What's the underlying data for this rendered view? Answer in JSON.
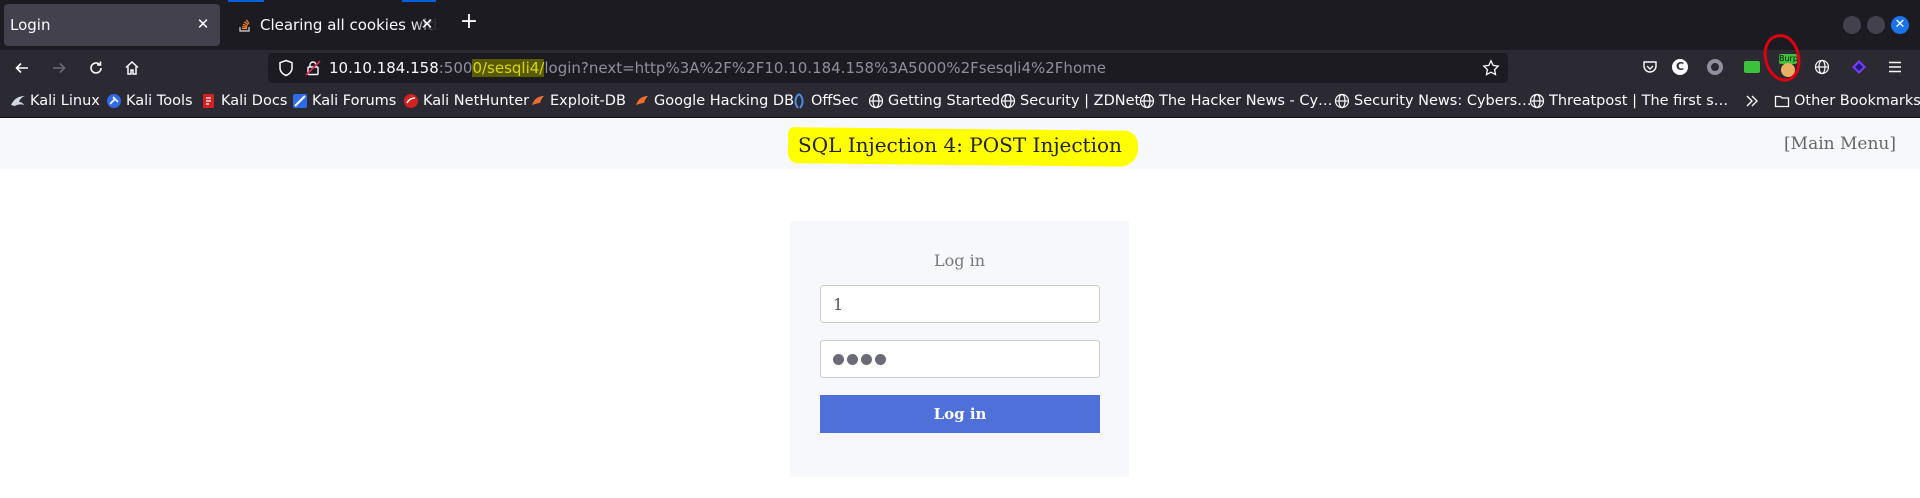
{
  "browser": {
    "tabs": [
      {
        "title": "Login",
        "active": true
      },
      {
        "title": "Clearing all cookies with JavaScript",
        "active": false
      }
    ],
    "url": {
      "host": "10.10.184.158",
      "port": ":500",
      "highlighted": "0/sesqli4/",
      "rest": "login?next=http%3A%2F%2F10.10.184.158%3A5000%2Fsesqli4%2Fhome"
    },
    "extensions": [
      {
        "name": "pocket-icon"
      },
      {
        "name": "c-extension-icon",
        "text": "C"
      },
      {
        "name": "settings-extension-icon"
      },
      {
        "name": "green-extension-icon"
      },
      {
        "name": "burp-extension-icon",
        "text": "Burp"
      },
      {
        "name": "globe-extension-icon"
      },
      {
        "name": "purple-extension-icon"
      },
      {
        "name": "menu-icon"
      }
    ],
    "bookmarks": [
      "Kali Linux",
      "Kali Tools",
      "Kali Docs",
      "Kali Forums",
      "Kali NetHunter",
      "Exploit-DB",
      "Google Hacking DB",
      "OffSec",
      "Getting Started",
      "Security | ZDNet",
      "The Hacker News - Cy…",
      "Security News: Cybers…",
      "Threatpost | The first s…"
    ],
    "other_bookmarks": "Other Bookmarks"
  },
  "page": {
    "title": "SQL Injection 4: POST Injection",
    "main_menu": "[Main Menu]",
    "login": {
      "heading": "Log in",
      "username_value": "1",
      "password_dots": 4,
      "button_label": "Log in"
    }
  },
  "colors": {
    "accent": "#4f6fd9",
    "highlight": "#ffff00",
    "annotation": "#e00010"
  }
}
